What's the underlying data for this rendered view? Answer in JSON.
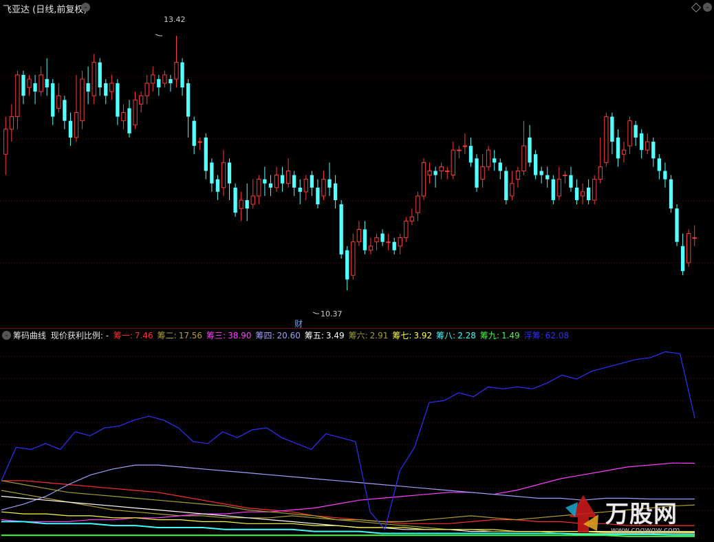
{
  "header": {
    "title": "飞亚达 (日线,前复权)",
    "menu_icon": "chevron-down-icon",
    "right_icons": [
      "diamond-icon",
      "settings-icon"
    ]
  },
  "price_panel": {
    "high_label": "13.42",
    "low_label": "10.37",
    "event_marker": "财",
    "up_color": "#ff3b3b",
    "down_color": "#54ffff"
  },
  "indicator": {
    "name": "筹码曲线",
    "caption": "现价获利比例: -",
    "series": [
      {
        "label": "筹一:",
        "value": "7.46",
        "color": "#ff3030"
      },
      {
        "label": "筹二:",
        "value": "17.56",
        "color": "#b0a030"
      },
      {
        "label": "筹三:",
        "value": "38.90",
        "color": "#ff40ff"
      },
      {
        "label": "筹四:",
        "value": "20.60",
        "color": "#a0a0ff"
      },
      {
        "label": "筹五:",
        "value": "3.49",
        "color": "#ffffff"
      },
      {
        "label": "筹六:",
        "value": "2.91",
        "color": "#a0a030"
      },
      {
        "label": "筹七:",
        "value": "3.92",
        "color": "#ffff40"
      },
      {
        "label": "筹八:",
        "value": "2.28",
        "color": "#40ffff"
      },
      {
        "label": "筹九:",
        "value": "1.49",
        "color": "#40ff40"
      },
      {
        "label": "浮筹:",
        "value": "62.08",
        "color": "#3030ff"
      }
    ]
  },
  "watermark": {
    "brand": "万股网",
    "url": "www.cngwgw.com"
  },
  "chart_data": [
    {
      "type": "candlestick",
      "title": "",
      "annotations": [
        "13.42",
        "10.37",
        "财"
      ],
      "ylim": [
        10.0,
        13.6
      ],
      "candles": [
        [
          12.0,
          12.3,
          11.75,
          12.45
        ],
        [
          12.3,
          12.45,
          12.15,
          12.6
        ],
        [
          12.45,
          12.95,
          12.3,
          13.0
        ],
        [
          12.95,
          12.7,
          12.6,
          13.0
        ],
        [
          12.8,
          12.9,
          12.7,
          12.95
        ],
        [
          12.85,
          12.75,
          12.6,
          12.95
        ],
        [
          12.75,
          12.95,
          12.7,
          13.05
        ],
        [
          12.9,
          12.8,
          12.7,
          13.15
        ],
        [
          12.85,
          12.45,
          12.35,
          12.9
        ],
        [
          12.55,
          12.7,
          12.5,
          12.85
        ],
        [
          12.65,
          12.4,
          12.3,
          12.7
        ],
        [
          12.4,
          12.2,
          12.1,
          12.5
        ],
        [
          12.2,
          12.5,
          12.15,
          12.95
        ],
        [
          12.4,
          12.9,
          12.3,
          13.0
        ],
        [
          12.85,
          12.75,
          12.6,
          13.05
        ],
        [
          12.7,
          13.1,
          12.6,
          13.2
        ],
        [
          13.1,
          12.8,
          12.7,
          13.15
        ],
        [
          12.85,
          12.7,
          12.6,
          12.9
        ],
        [
          12.75,
          12.85,
          12.65,
          12.95
        ],
        [
          12.85,
          12.45,
          12.35,
          12.9
        ],
        [
          12.4,
          12.5,
          12.3,
          12.6
        ],
        [
          12.55,
          12.25,
          12.2,
          12.65
        ],
        [
          12.35,
          12.65,
          12.3,
          12.75
        ],
        [
          12.6,
          12.7,
          12.5,
          12.75
        ],
        [
          12.7,
          12.85,
          12.6,
          12.95
        ],
        [
          12.85,
          12.95,
          12.75,
          13.05
        ],
        [
          12.9,
          12.8,
          12.7,
          12.95
        ],
        [
          12.85,
          12.95,
          12.8,
          13.0
        ],
        [
          12.9,
          12.85,
          12.75,
          12.95
        ],
        [
          12.9,
          13.1,
          12.8,
          13.42
        ],
        [
          13.1,
          12.8,
          12.7,
          13.15
        ],
        [
          12.85,
          12.45,
          12.2,
          12.9
        ],
        [
          12.4,
          12.1,
          12.0,
          12.45
        ],
        [
          12.15,
          12.15,
          12.05,
          12.2
        ],
        [
          12.2,
          11.8,
          11.7,
          12.25
        ],
        [
          11.9,
          11.65,
          11.55,
          11.95
        ],
        [
          11.7,
          11.55,
          11.45,
          11.75
        ],
        [
          11.6,
          11.9,
          11.5,
          12.05
        ],
        [
          11.9,
          11.65,
          11.45,
          11.95
        ],
        [
          11.6,
          11.3,
          11.25,
          11.65
        ],
        [
          11.35,
          11.45,
          11.2,
          11.55
        ],
        [
          11.45,
          11.35,
          11.2,
          11.65
        ],
        [
          11.4,
          11.5,
          11.35,
          11.7
        ],
        [
          11.5,
          11.7,
          11.4,
          11.75
        ],
        [
          11.7,
          11.65,
          11.5,
          11.85
        ],
        [
          11.65,
          11.6,
          11.5,
          11.75
        ],
        [
          11.6,
          11.75,
          11.55,
          11.85
        ],
        [
          11.75,
          11.65,
          11.55,
          11.85
        ],
        [
          11.65,
          11.8,
          11.6,
          11.95
        ],
        [
          11.75,
          11.6,
          11.5,
          11.8
        ],
        [
          11.6,
          11.55,
          11.4,
          11.7
        ],
        [
          11.55,
          11.7,
          11.45,
          11.75
        ],
        [
          11.75,
          11.6,
          11.5,
          11.8
        ],
        [
          11.6,
          11.4,
          11.35,
          11.7
        ],
        [
          11.5,
          11.7,
          11.45,
          11.8
        ],
        [
          11.7,
          11.6,
          11.5,
          11.9
        ],
        [
          11.65,
          11.45,
          11.35,
          11.75
        ],
        [
          11.4,
          10.8,
          10.75,
          11.45
        ],
        [
          10.85,
          10.5,
          10.37,
          10.9
        ],
        [
          10.55,
          10.95,
          10.5,
          11.05
        ],
        [
          10.95,
          11.1,
          10.9,
          11.2
        ],
        [
          11.1,
          10.85,
          10.8,
          11.2
        ],
        [
          10.85,
          10.9,
          10.8,
          11.0
        ],
        [
          10.95,
          11.0,
          10.85,
          11.05
        ],
        [
          11.05,
          10.95,
          10.9,
          11.1
        ],
        [
          10.95,
          10.95,
          10.85,
          11.05
        ],
        [
          10.95,
          10.85,
          10.8,
          11.0
        ],
        [
          10.9,
          11.0,
          10.8,
          11.05
        ],
        [
          11.0,
          11.2,
          10.95,
          11.25
        ],
        [
          11.2,
          11.25,
          11.15,
          11.35
        ],
        [
          11.3,
          11.5,
          11.2,
          11.55
        ],
        [
          11.5,
          11.9,
          11.45,
          11.95
        ],
        [
          11.75,
          11.8,
          11.65,
          11.9
        ],
        [
          11.8,
          11.75,
          11.6,
          11.85
        ],
        [
          11.8,
          11.85,
          11.7,
          11.9
        ],
        [
          11.8,
          11.8,
          11.7,
          11.85
        ],
        [
          11.75,
          12.05,
          11.7,
          12.15
        ],
        [
          12.05,
          12.05,
          11.95,
          12.1
        ],
        [
          12.1,
          12.1,
          12.0,
          12.25
        ],
        [
          12.1,
          11.9,
          11.85,
          12.2
        ],
        [
          11.95,
          11.6,
          11.55,
          12.0
        ],
        [
          11.7,
          11.85,
          11.6,
          12.0
        ],
        [
          11.85,
          12.05,
          11.8,
          12.1
        ],
        [
          11.95,
          11.9,
          11.8,
          12.05
        ],
        [
          11.9,
          11.8,
          11.7,
          11.95
        ],
        [
          11.8,
          11.45,
          11.4,
          11.85
        ],
        [
          11.5,
          11.65,
          11.45,
          11.8
        ],
        [
          11.7,
          11.8,
          11.6,
          11.85
        ],
        [
          11.8,
          12.1,
          11.75,
          12.4
        ],
        [
          12.2,
          11.9,
          11.85,
          12.35
        ],
        [
          12.0,
          11.75,
          11.7,
          12.05
        ],
        [
          11.8,
          11.75,
          11.65,
          11.85
        ],
        [
          11.75,
          11.7,
          11.6,
          11.85
        ],
        [
          11.7,
          11.45,
          11.4,
          11.75
        ],
        [
          11.5,
          11.7,
          11.45,
          11.85
        ],
        [
          11.75,
          11.75,
          11.65,
          11.8
        ],
        [
          11.75,
          11.6,
          11.55,
          11.85
        ],
        [
          11.6,
          11.45,
          11.4,
          11.7
        ],
        [
          11.5,
          11.55,
          11.4,
          11.65
        ],
        [
          11.6,
          11.45,
          11.4,
          11.7
        ],
        [
          11.45,
          11.7,
          11.4,
          11.75
        ],
        [
          11.7,
          11.85,
          11.65,
          12.2
        ],
        [
          11.9,
          12.45,
          11.85,
          12.5
        ],
        [
          12.45,
          12.15,
          12.0,
          12.5
        ],
        [
          12.2,
          11.95,
          11.85,
          12.3
        ],
        [
          12.0,
          12.05,
          11.9,
          12.15
        ],
        [
          12.1,
          12.4,
          12.0,
          12.45
        ],
        [
          12.35,
          12.2,
          12.1,
          12.4
        ],
        [
          12.25,
          12.05,
          11.95,
          12.3
        ],
        [
          12.05,
          12.15,
          12.0,
          12.25
        ],
        [
          12.15,
          11.95,
          11.85,
          12.2
        ],
        [
          11.95,
          11.8,
          11.7,
          12.0
        ],
        [
          11.8,
          11.7,
          11.6,
          11.9
        ],
        [
          11.7,
          11.35,
          11.3,
          11.75
        ],
        [
          11.35,
          10.95,
          10.9,
          11.4
        ],
        [
          10.9,
          10.6,
          10.55,
          11.05
        ],
        [
          10.7,
          11.05,
          10.65,
          11.1
        ],
        [
          11.0,
          11.0,
          10.9,
          11.15
        ]
      ]
    },
    {
      "type": "line",
      "title": "筹码曲线",
      "series": [
        {
          "name": "筹一",
          "values": [
            30,
            30,
            29,
            28,
            27,
            26,
            25,
            24,
            22,
            20,
            18,
            16,
            15,
            14,
            12,
            11,
            10,
            9,
            8,
            8,
            8,
            9,
            10,
            10,
            9,
            9,
            8,
            8,
            7,
            7,
            7,
            7
          ]
        },
        {
          "name": "筹二",
          "values": [
            25,
            23,
            21,
            19,
            17,
            15,
            14,
            13,
            12,
            12,
            11,
            11,
            11,
            12,
            11,
            10,
            10,
            9,
            9,
            10,
            11,
            12,
            11,
            10,
            11,
            12,
            13,
            14,
            15,
            16,
            17,
            17.56
          ]
        },
        {
          "name": "筹三",
          "values": [
            10,
            9,
            9,
            9,
            10,
            10,
            11,
            11,
            12,
            13,
            13,
            14,
            14,
            15,
            16,
            18,
            20,
            21,
            22,
            23,
            24,
            24,
            23,
            25,
            28,
            31,
            33,
            35,
            37,
            38,
            39,
            38.9
          ]
        },
        {
          "name": "筹四",
          "values": [
            15,
            18,
            22,
            28,
            33,
            36,
            38,
            38,
            37,
            36,
            35,
            34,
            33,
            32,
            31,
            30,
            29,
            28,
            27,
            26,
            25,
            24,
            23,
            22,
            21,
            21,
            20,
            21,
            21,
            20.6,
            20.6,
            20.6
          ]
        },
        {
          "name": "筹五",
          "values": [
            22,
            21,
            20,
            19,
            18,
            17,
            16,
            15,
            14,
            13,
            12,
            11,
            10,
            9,
            8,
            7,
            6,
            6,
            5,
            5,
            5,
            4,
            4,
            4,
            4,
            4,
            4,
            3.5,
            3.5,
            3.5,
            3.5,
            3.49
          ]
        },
        {
          "name": "筹六",
          "values": [
            30,
            28,
            26,
            24,
            23,
            22,
            21,
            20,
            19,
            18,
            17,
            15,
            14,
            13,
            12,
            10,
            9,
            8,
            7,
            6,
            5,
            5,
            4,
            4,
            4,
            3,
            3,
            3,
            3,
            3,
            3,
            2.91
          ]
        },
        {
          "name": "筹七",
          "values": [
            14,
            13,
            13,
            12,
            12,
            11,
            11,
            10,
            10,
            9,
            9,
            8,
            8,
            8,
            7,
            7,
            6,
            6,
            6,
            5,
            5,
            5,
            5,
            4,
            4,
            4,
            4,
            4,
            4,
            4,
            4,
            3.92
          ]
        },
        {
          "name": "筹八",
          "values": [
            9,
            9,
            8,
            8,
            8,
            7,
            7,
            6,
            6,
            6,
            5,
            5,
            5,
            5,
            4,
            4,
            4,
            3,
            3,
            3,
            3,
            3,
            3,
            3,
            3,
            3,
            2.5,
            2.5,
            2.5,
            2.5,
            2.3,
            2.28
          ]
        },
        {
          "name": "筹九",
          "values": [
            2,
            2,
            2,
            2,
            2,
            2,
            2,
            2,
            2,
            2,
            2,
            2,
            2,
            2,
            2,
            2,
            2,
            2,
            2,
            2,
            2,
            2,
            2,
            2,
            2,
            2,
            2,
            2,
            1.5,
            1.5,
            1.5,
            1.49
          ]
        },
        {
          "name": "浮筹",
          "values": [
            30,
            47,
            46,
            49,
            46,
            55,
            53,
            57,
            58,
            61,
            63,
            61,
            57,
            50,
            49,
            55,
            52,
            56,
            57,
            52,
            49,
            46,
            54,
            52,
            50,
            14,
            5,
            35,
            47,
            70,
            71,
            75,
            73,
            78,
            77,
            78,
            77,
            80,
            84,
            82,
            86,
            88,
            90,
            92,
            93,
            96,
            95,
            62.08
          ]
        }
      ]
    }
  ]
}
